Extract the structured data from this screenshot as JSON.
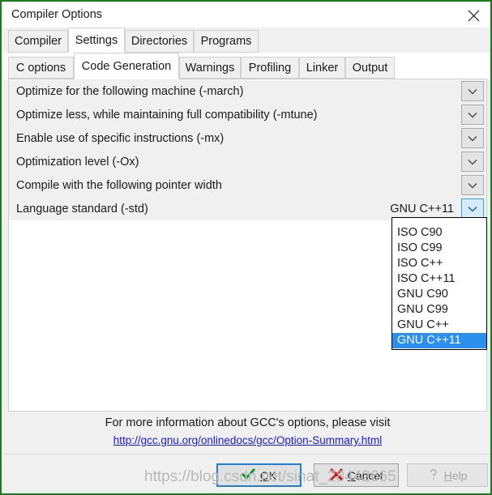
{
  "window": {
    "title": "Compiler Options",
    "close_icon": "close-icon"
  },
  "outer_tabs": [
    {
      "label": "Compiler",
      "selected": false
    },
    {
      "label": "Settings",
      "selected": true
    },
    {
      "label": "Directories",
      "selected": false
    },
    {
      "label": "Programs",
      "selected": false
    }
  ],
  "inner_tabs": [
    {
      "label": "C options",
      "selected": false
    },
    {
      "label": "Code Generation",
      "selected": true
    },
    {
      "label": "Warnings",
      "selected": false
    },
    {
      "label": "Profiling",
      "selected": false
    },
    {
      "label": "Linker",
      "selected": false
    },
    {
      "label": "Output",
      "selected": false
    }
  ],
  "options": [
    {
      "label": "Optimize for the following machine (-march)",
      "value": "",
      "active": false
    },
    {
      "label": "Optimize less, while maintaining full compatibility (-mtune)",
      "value": "",
      "active": false
    },
    {
      "label": "Enable use of specific instructions (-mx)",
      "value": "",
      "active": false
    },
    {
      "label": "Optimization level (-Ox)",
      "value": "",
      "active": false
    },
    {
      "label": "Compile with the following pointer width",
      "value": "",
      "active": false
    },
    {
      "label": "Language standard (-std)",
      "value": "GNU C++11",
      "active": true
    }
  ],
  "dropdown": {
    "open": true,
    "selected": "GNU C++11",
    "items": [
      "ISO C90",
      "ISO C99",
      "ISO C++",
      "ISO C++11",
      "GNU C90",
      "GNU C99",
      "GNU C++",
      "GNU C++11"
    ]
  },
  "footer": {
    "info_text": "For more information about GCC's options, please visit",
    "link_text": "http://gcc.gnu.org/onlinedocs/gcc/Option-Summary.html"
  },
  "buttons": {
    "ok": {
      "label": "OK",
      "accel": "O",
      "icon": "checkmark-icon",
      "enabled": true,
      "default": true
    },
    "cancel": {
      "label": "Cancel",
      "accel": "C",
      "icon": "red-x-icon",
      "enabled": true,
      "default": false
    },
    "help": {
      "label": "Help",
      "accel": "H",
      "icon": "question-mark-icon",
      "enabled": false,
      "default": false
    }
  },
  "watermark": {
    "text": "https://blog.csdn.net/sinat_28442665"
  },
  "colors": {
    "window_border": "#1e7a1e",
    "selection_blue": "#2a8fee",
    "focus_blue": "#1e7fd4",
    "link_blue": "#1919e6",
    "row_grey": "#f0f0f0",
    "check_green": "#0f9d26",
    "cancel_red": "#cc1111"
  }
}
